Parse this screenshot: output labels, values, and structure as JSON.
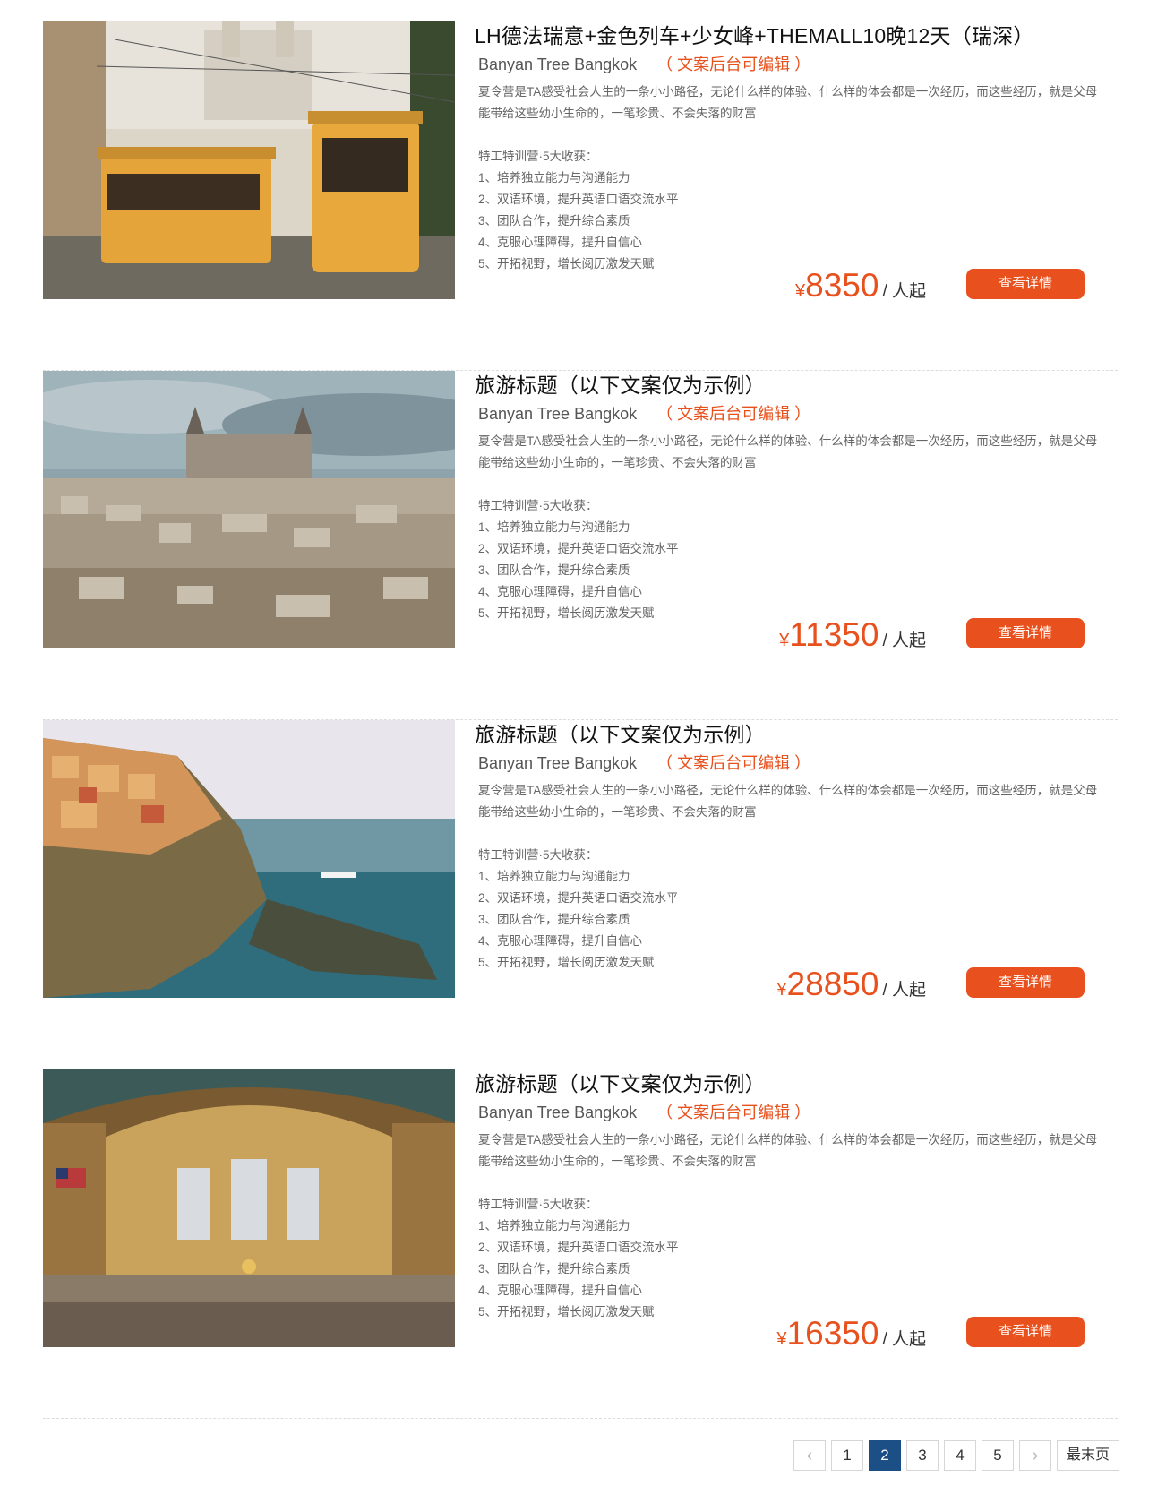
{
  "items": [
    {
      "title": "LH德法瑞意+金色列车+少女峰+THEMALL10晚12天（瑞深）",
      "hotel": "Banyan Tree Bangkok",
      "edit_note": "（ 文案后台可编辑 ）",
      "description": "夏令营是TA感受社会人生的一条小小路径，无论什么样的体验、什么样的体会都是一次经历，而这些经历，就是父母能带给这些幼小生命的，一笔珍贵、不会失落的财富",
      "gains_title": "特工特训营·5大收获：",
      "gains": [
        "1、培养独立能力与沟通能力",
        "2、双语环境，提升英语口语交流水平",
        "3、团队合作，提升综合素质",
        "4、克服心理障碍，提升自信心",
        "5、开拓视野，增长阅历激发天赋"
      ],
      "currency": "¥",
      "price": "8350",
      "unit": "/ 人起",
      "button": "查看详情",
      "image": "tram-photo"
    },
    {
      "title": "旅游标题（以下文案仅为示例）",
      "hotel": "Banyan Tree Bangkok",
      "edit_note": "（ 文案后台可编辑 ）",
      "description": "夏令营是TA感受社会人生的一条小小路径，无论什么样的体验、什么样的体会都是一次经历，而这些经历，就是父母能带给这些幼小生命的，一笔珍贵、不会失落的财富",
      "gains_title": "特工特训营·5大收获：",
      "gains": [
        "1、培养独立能力与沟通能力",
        "2、双语环境，提升英语口语交流水平",
        "3、团队合作，提升综合素质",
        "4、克服心理障碍，提升自信心",
        "5、开拓视野，增长阅历激发天赋"
      ],
      "currency": "¥",
      "price": "11350",
      "unit": "/ 人起",
      "button": "查看详情",
      "image": "castle-city-photo"
    },
    {
      "title": "旅游标题（以下文案仅为示例）",
      "hotel": "Banyan Tree Bangkok",
      "edit_note": "（ 文案后台可编辑 ）",
      "description": "夏令营是TA感受社会人生的一条小小路径，无论什么样的体验、什么样的体会都是一次经历，而这些经历，就是父母能带给这些幼小生命的，一笔珍贵、不会失落的财富",
      "gains_title": "特工特训营·5大收获：",
      "gains": [
        "1、培养独立能力与沟通能力",
        "2、双语环境，提升英语口语交流水平",
        "3、团队合作，提升综合素质",
        "4、克服心理障碍，提升自信心",
        "5、开拓视野，增长阅历激发天赋"
      ],
      "currency": "¥",
      "price": "28850",
      "unit": "/ 人起",
      "button": "查看详情",
      "image": "coastal-village-photo"
    },
    {
      "title": "旅游标题（以下文案仅为示例）",
      "hotel": "Banyan Tree Bangkok",
      "edit_note": "（ 文案后台可编辑 ）",
      "description": "夏令营是TA感受社会人生的一条小小路径，无论什么样的体验、什么样的体会都是一次经历，而这些经历，就是父母能带给这些幼小生命的，一笔珍贵、不会失落的财富",
      "gains_title": "特工特训营·5大收获：",
      "gains": [
        "1、培养独立能力与沟通能力",
        "2、双语环境，提升英语口语交流水平",
        "3、团队合作，提升综合素质",
        "4、克服心理障碍，提升自信心",
        "5、开拓视野，增长阅历激发天赋"
      ],
      "currency": "¥",
      "price": "16350",
      "unit": "/ 人起",
      "button": "查看详情",
      "image": "grand-terminal-photo"
    }
  ],
  "pagination": {
    "prev": "‹",
    "pages": [
      "1",
      "2",
      "3",
      "4",
      "5"
    ],
    "current": "2",
    "next": "›",
    "last": "最末页"
  },
  "colors": {
    "accent": "#e8511d",
    "page_active": "#1c4f86"
  }
}
